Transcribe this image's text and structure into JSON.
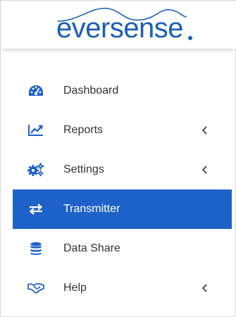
{
  "brand": {
    "logo_text": "eversense",
    "accent_color": "#1e62c9",
    "logo_color": "#1b5fb4"
  },
  "nav": {
    "items": [
      {
        "label": "Dashboard",
        "icon": "dashboard-icon",
        "has_submenu": false,
        "active": false
      },
      {
        "label": "Reports",
        "icon": "line-chart-icon",
        "has_submenu": true,
        "active": false
      },
      {
        "label": "Settings",
        "icon": "cogs-icon",
        "has_submenu": true,
        "active": false
      },
      {
        "label": "Transmitter",
        "icon": "exchange-icon",
        "has_submenu": false,
        "active": true
      },
      {
        "label": "Data Share",
        "icon": "database-icon",
        "has_submenu": false,
        "active": false
      },
      {
        "label": "Help",
        "icon": "handshake-icon",
        "has_submenu": true,
        "active": false
      }
    ]
  }
}
